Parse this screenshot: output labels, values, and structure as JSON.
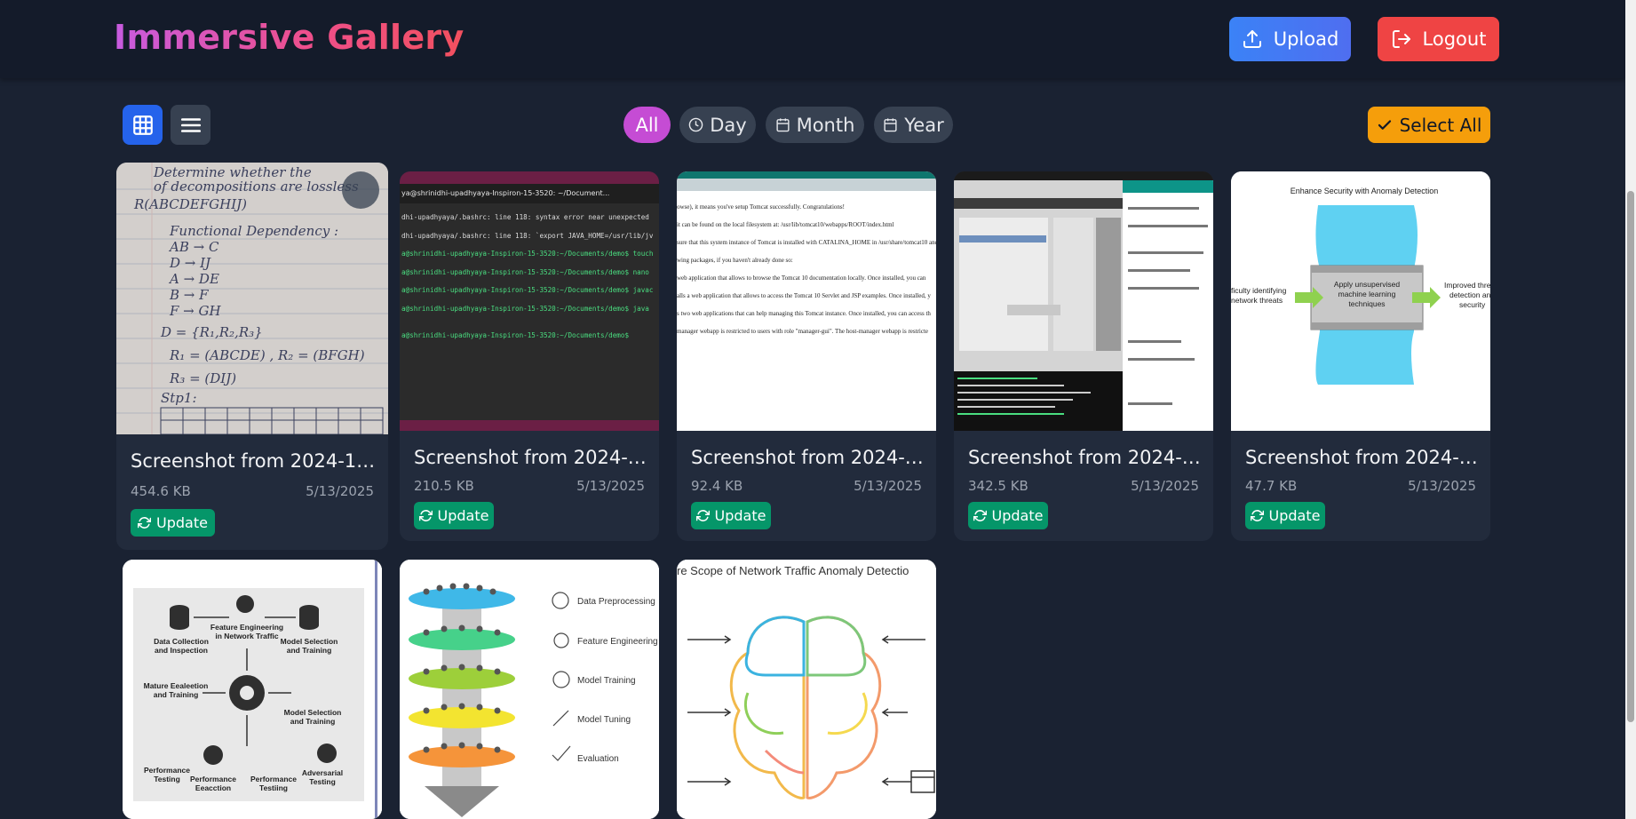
{
  "app": {
    "brand": "Immersive Gallery",
    "upload_label": "Upload",
    "logout_label": "Logout",
    "brand_gradient": [
      "#c75be0",
      "#ee4f8c",
      "#f2505e"
    ]
  },
  "toolbar": {
    "filters": [
      {
        "label": "All",
        "icon": "none",
        "active": true
      },
      {
        "label": "Day",
        "icon": "clock-icon",
        "active": false
      },
      {
        "label": "Month",
        "icon": "calendar-icon",
        "active": false
      },
      {
        "label": "Year",
        "icon": "calendar-icon",
        "active": false
      }
    ],
    "select_all_label": "Select All",
    "active_view": "grid"
  },
  "cards": [
    {
      "title": "Screenshot from 2024-12-...",
      "size": "454.6 KB",
      "date": "5/13/2025",
      "action": "Update",
      "thumbnail": "handwritten-notes"
    },
    {
      "title": "Screenshot from 2024-12-...",
      "size": "210.5 KB",
      "date": "5/13/2025",
      "action": "Update",
      "thumbnail": "terminal"
    },
    {
      "title": "Screenshot from 2024-12-...",
      "size": "92.4 KB",
      "date": "5/13/2025",
      "action": "Update",
      "thumbnail": "tomcat-page"
    },
    {
      "title": "Screenshot from 2024-12-...",
      "size": "342.5 KB",
      "date": "5/13/2025",
      "action": "Update",
      "thumbnail": "desktop-apps"
    },
    {
      "title": "Screenshot from 2024-12-...",
      "size": "47.7 KB",
      "date": "5/13/2025",
      "action": "Update",
      "thumbnail": "anomaly-diagram"
    }
  ],
  "thumbs": {
    "terminal": {
      "titlebar": "ya@shrinidhi-upadhyaya-Inspiron-15-3520: ~/Document...",
      "lines": [
        "dhi-upadhyaya/.bashrc: line 118: syntax error near unexpected",
        "dhi-upadhyaya/.bashrc: line 118: `export JAVA_HOME=/usr/lib/jv",
        "a@shrinidhi-upadhyaya-Inspiron-15-3520:~/Documents/demo$ touch",
        "a@shrinidhi-upadhyaya-Inspiron-15-3520:~/Documents/demo$ nano",
        "a@shrinidhi-upadhyaya-Inspiron-15-3520:~/Documents/demo$ javac",
        "a@shrinidhi-upadhyaya-Inspiron-15-3520:~/Documents/demo$ java",
        "a@shrinidhi-upadhyaya-Inspiron-15-3520:~/Documents/demo$"
      ]
    },
    "tomcat": {
      "lines": [
        "owse), it means you've setup Tomcat successfully. Congratulations!",
        "it can be found on the local filesystem at: /usr/lib/tomcat10/webapps/ROOT/index.html",
        "sure that this system instance of Tomcat is installed with CATALINA_HOME in /usr/share/tomcat10 and",
        "wing packages, if you haven't already done so:",
        "web application that allows to browse the Tomcat 10 documentation locally. Once installed, you can",
        "alls a web application that allows to access the Tomcat 10 Servlet and JSP examples. Once installed, y",
        "s two web applications that can help managing this Tomcat instance. Once installed, you can access th",
        "manager webapp is restricted to users with role \"manager-gui\". The host-manager webapp is restricte"
      ]
    },
    "anomaly": {
      "title": "Enhance Security with Anomaly Detection",
      "left": "ficulty identifying\nnetwork threats",
      "center": "Apply unsupervised\nmachine learning\ntechniques",
      "right": "Improved thre\ndetection an\nsecurity"
    },
    "pipeline": {
      "labels": [
        "Data Collection\nand Inspection",
        "Feature Engineering\nin Network Traffic",
        "Model Selection\nand Training",
        "Mature Eealeetion\nand Training",
        "Model Selection\nand Training",
        "Performance\nTesting",
        "Performance\nEeacction",
        "Performance\nTestiing",
        "Adversarial\nTesting"
      ]
    },
    "layers": {
      "labels": [
        "Data Preprocessing",
        "Feature Engineering",
        "Model Training",
        "Model Tuning",
        "Evaluation"
      ]
    },
    "brain": {
      "title": "re Scope of Network Traffic Anomaly Detectio"
    }
  },
  "bottom_cards": [
    {
      "thumbnail": "ml-pipeline"
    },
    {
      "thumbnail": "layered-stack"
    },
    {
      "thumbnail": "brain-diagram"
    }
  ]
}
